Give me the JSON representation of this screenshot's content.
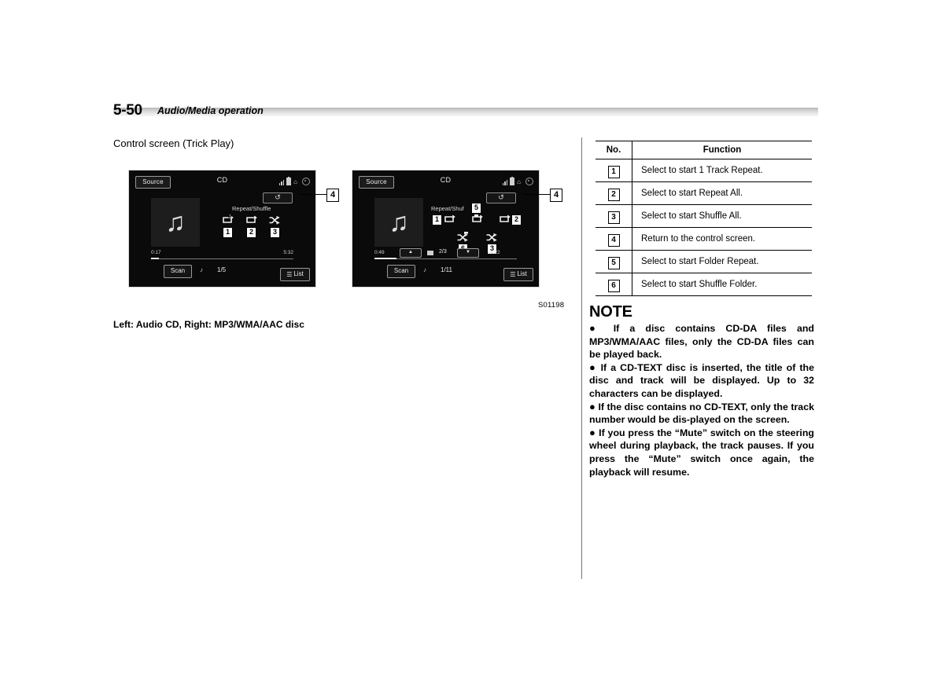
{
  "header": {
    "page_number": "5-50",
    "section": "Audio/Media operation"
  },
  "subheading": "Control screen (Trick Play)",
  "figure": {
    "id": "S01198",
    "caption": "Left: Audio CD, Right: MP3/WMA/AAC disc",
    "left_screen": {
      "source_button": "Source",
      "title": "CD",
      "mode_label": "Repeat/Shuffle",
      "elapsed_time": "0:17",
      "total_time": "5:32",
      "scan_button": "Scan",
      "track_counter": "1/5",
      "list_button": "List",
      "callout_return": "4",
      "callouts": [
        "1",
        "2",
        "3"
      ]
    },
    "right_screen": {
      "source_button": "Source",
      "title": "CD",
      "mode_label": "Repeat/Shuf",
      "elapsed_time": "0:49",
      "total_time": "4:22",
      "folder_counter": "2/3",
      "scan_button": "Scan",
      "track_counter": "1/11",
      "list_button": "List",
      "callout_return": "4",
      "callouts": [
        "1",
        "2",
        "3",
        "5",
        "6"
      ]
    }
  },
  "table": {
    "headers": [
      "No.",
      "Function"
    ],
    "rows": [
      {
        "no": "1",
        "function": "Select to start 1 Track Repeat."
      },
      {
        "no": "2",
        "function": "Select to start Repeat All."
      },
      {
        "no": "3",
        "function": "Select to start Shuffle All."
      },
      {
        "no": "4",
        "function": "Return to the control screen."
      },
      {
        "no": "5",
        "function": "Select to start Folder Repeat."
      },
      {
        "no": "6",
        "function": "Select to start Shuffle Folder."
      }
    ]
  },
  "note": {
    "title": "NOTE",
    "bullet_char": "●",
    "items": [
      "If a disc contains CD-DA files and MP3/WMA/AAC files, only the CD-DA files can be played back.",
      "If a CD-TEXT disc is inserted, the title of the disc and track will be displayed. Up to 32 characters can be displayed.",
      "If the disc contains no CD-TEXT, only the track number would be dis-played on the screen.",
      "If you press the “Mute” switch on the steering wheel during playback, the track pauses. If you press the “Mute” switch once again, the playback will resume."
    ]
  }
}
